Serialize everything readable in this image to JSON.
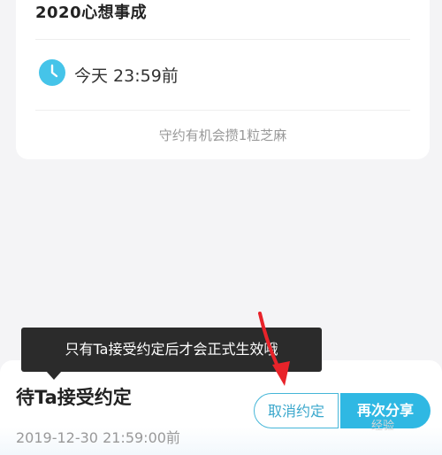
{
  "card": {
    "title": "2020心想事成",
    "deadline": "今天 23:59前",
    "hint": "守约有机会攒1粒芝麻"
  },
  "tooltip": {
    "text": "只有Ta接受约定后才会正式生效哦"
  },
  "bottom_bar": {
    "status": "待Ta接受约定",
    "timestamp": "2019-12-30 21:59:00前",
    "cancel_label": "取消约定",
    "share_label": "再次分享"
  },
  "watermark": {
    "text": "经验"
  },
  "icons": {
    "clock": "clock-icon",
    "annotation": "red-arrow-icon"
  },
  "colors": {
    "accent": "#2fb8e3",
    "clock": "#45c4e9",
    "arrow": "#e8232a"
  }
}
